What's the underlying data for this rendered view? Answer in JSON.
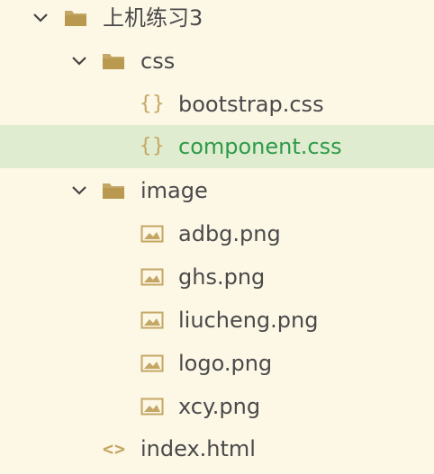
{
  "colors": {
    "background": "#fdf7e6",
    "selected_background": "#e0ecd0",
    "icon_gold": "#c4a764",
    "selected_text": "#2e9a4a",
    "text": "#4a4a4a"
  },
  "tree": {
    "root": {
      "label": "上机练习3",
      "expanded": true,
      "icon": "folder-icon"
    },
    "css_folder": {
      "label": "css",
      "expanded": true,
      "icon": "folder-icon",
      "files": [
        {
          "label": "bootstrap.css",
          "icon": "css-file-icon",
          "selected": false
        },
        {
          "label": "component.css",
          "icon": "css-file-icon",
          "selected": true
        }
      ]
    },
    "image_folder": {
      "label": "image",
      "expanded": true,
      "icon": "folder-icon",
      "files": [
        {
          "label": "adbg.png",
          "icon": "image-file-icon"
        },
        {
          "label": "ghs.png",
          "icon": "image-file-icon"
        },
        {
          "label": "liucheng.png",
          "icon": "image-file-icon"
        },
        {
          "label": "logo.png",
          "icon": "image-file-icon"
        },
        {
          "label": "xcy.png",
          "icon": "image-file-icon"
        }
      ]
    },
    "index_file": {
      "label": "index.html",
      "icon": "html-file-icon"
    }
  }
}
